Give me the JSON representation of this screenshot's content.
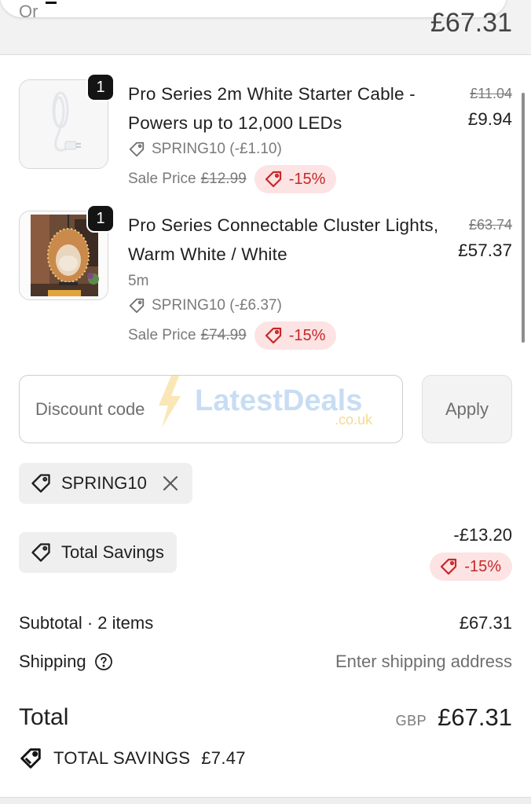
{
  "header": {
    "partial_text": "Or",
    "total": "£67.31"
  },
  "items": [
    {
      "qty": "1",
      "title": "Pro Series 2m White Starter Cable - Powers up to 12,000 LEDs",
      "variant": "",
      "discount_code": "SPRING10 (-£1.10)",
      "sale_label": "Sale Price",
      "sale_original": "£12.99",
      "sale_percent": "-15%",
      "price_old": "£11.04",
      "price_new": "£9.94",
      "thumb_icon": "cable-product-image"
    },
    {
      "qty": "1",
      "title": "Pro Series Connectable Cluster Lights, Warm White / White",
      "variant": "5m",
      "discount_code": "SPRING10 (-£6.37)",
      "sale_label": "Sale Price",
      "sale_original": "£74.99",
      "sale_percent": "-15%",
      "price_old": "£63.74",
      "price_new": "£57.37",
      "thumb_icon": "egg-chair-lights-product-image"
    }
  ],
  "discount": {
    "placeholder": "Discount code",
    "apply_label": "Apply",
    "applied_code": "SPRING10",
    "watermark_main": "LatestDeals",
    "watermark_sub": ".co.uk"
  },
  "savings": {
    "label": "Total Savings",
    "amount": "-£13.20",
    "percent": "-15%"
  },
  "summary": {
    "subtotal_label": "Subtotal · 2 items",
    "subtotal_value": "£67.31",
    "shipping_label": "Shipping",
    "shipping_value": "Enter shipping address",
    "total_label": "Total",
    "currency": "GBP",
    "total_value": "£67.31",
    "total_savings_label": "TOTAL SAVINGS",
    "total_savings_value": "£7.47"
  },
  "colors": {
    "badge_bg": "#fde3e3",
    "badge_text": "#c62828",
    "chip_bg": "#efefef"
  }
}
